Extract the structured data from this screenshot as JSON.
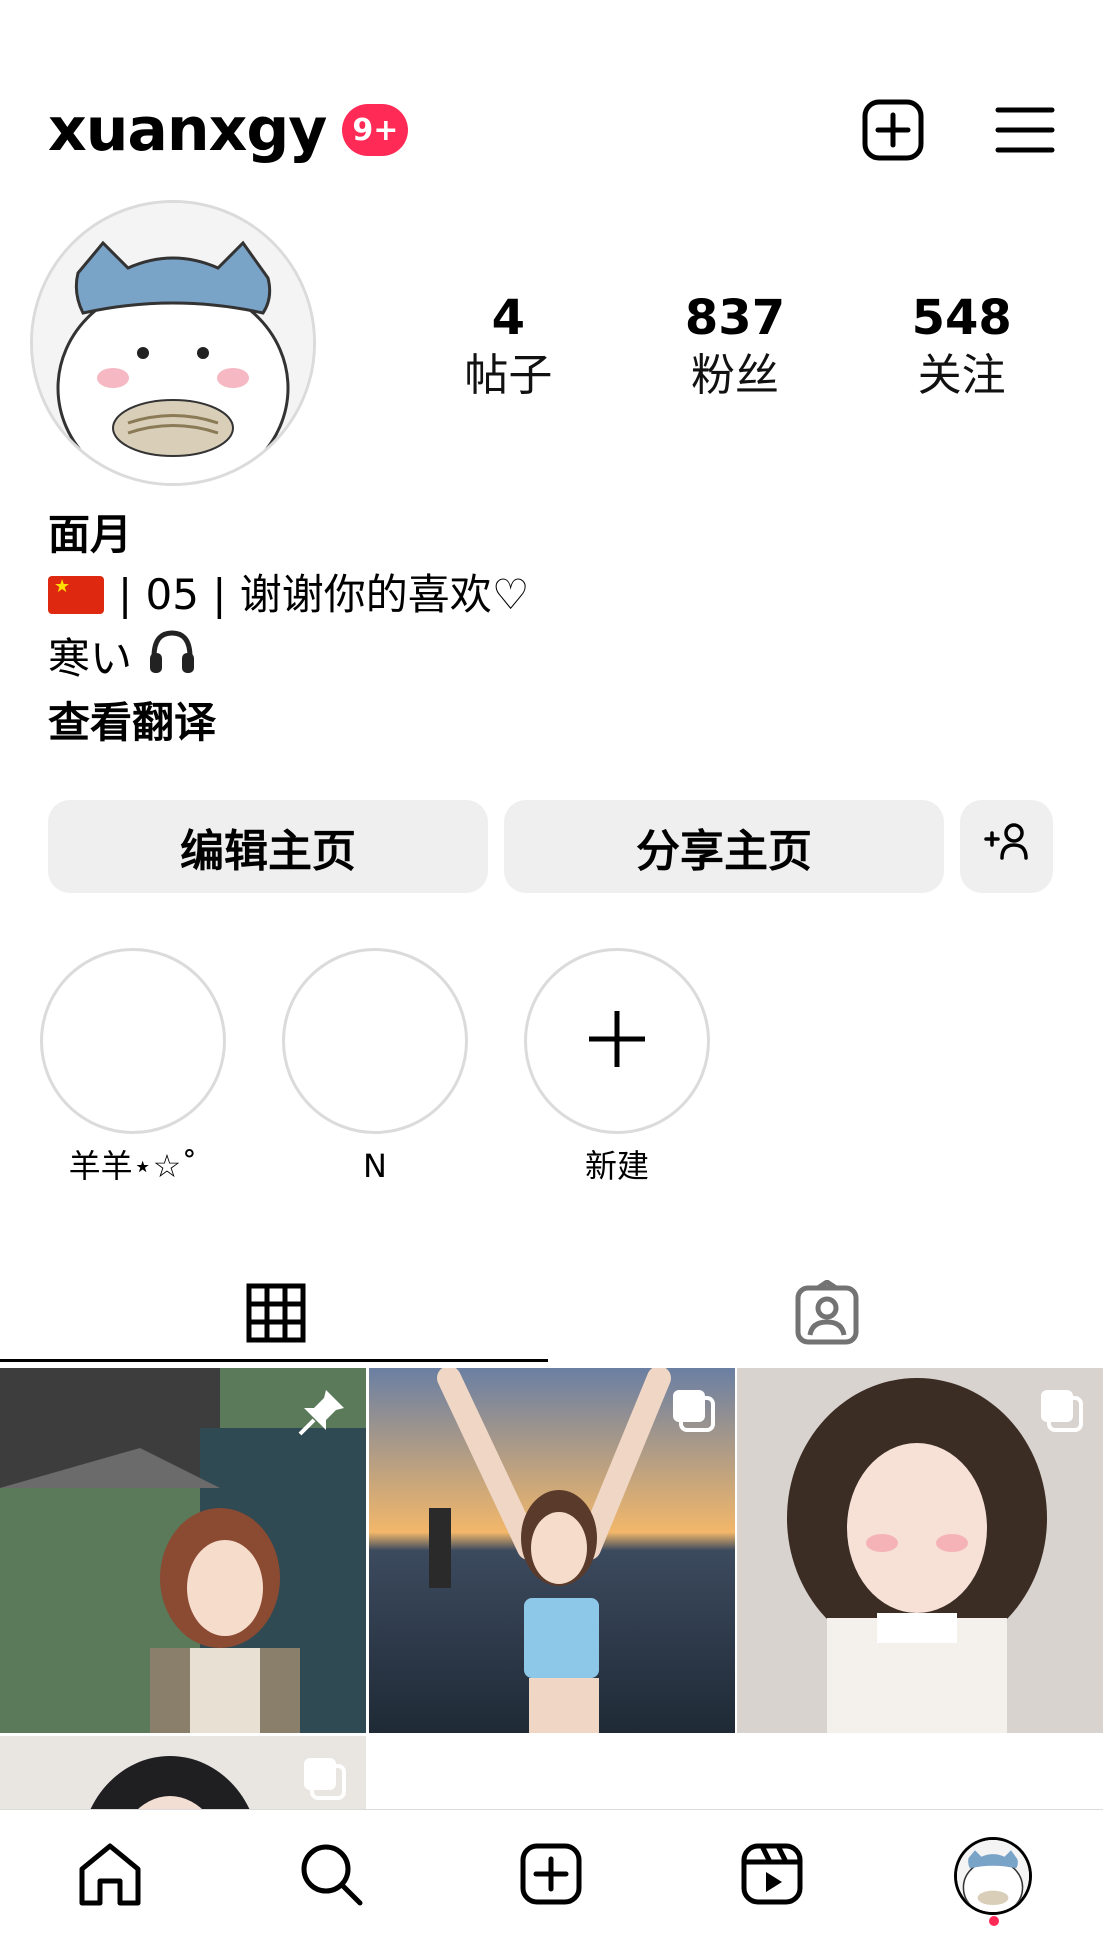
{
  "header": {
    "username": "xuanxgy",
    "notification_badge": "9+",
    "badge_color": "#ff2a55",
    "actions": [
      "create-icon",
      "menu-icon"
    ]
  },
  "profile": {
    "stats": [
      {
        "value": "4",
        "label": "帖子"
      },
      {
        "value": "837",
        "label": "粉丝"
      },
      {
        "value": "548",
        "label": "关注"
      }
    ],
    "bio": {
      "name": "面月",
      "line1": "| 05 | 谢谢你的喜欢♡",
      "line2": "寒い",
      "translate": "查看翻译"
    }
  },
  "buttons": {
    "edit_profile": "编辑主页",
    "share_profile": "分享主页"
  },
  "highlights": [
    {
      "label": "羊羊⋆☆˚"
    },
    {
      "label": "N"
    },
    {
      "label": "新建"
    }
  ],
  "tabs": [
    "grid-icon",
    "tagged-icon"
  ],
  "posts": [
    {
      "type": "pinned",
      "icon": "pin-icon"
    },
    {
      "type": "carousel",
      "icon": "carousel-icon"
    },
    {
      "type": "carousel",
      "icon": "carousel-icon"
    },
    {
      "type": "carousel",
      "icon": "carousel-icon"
    }
  ],
  "bottom_nav": [
    "home-icon",
    "search-icon",
    "create-icon",
    "reels-icon",
    "profile-avatar"
  ]
}
